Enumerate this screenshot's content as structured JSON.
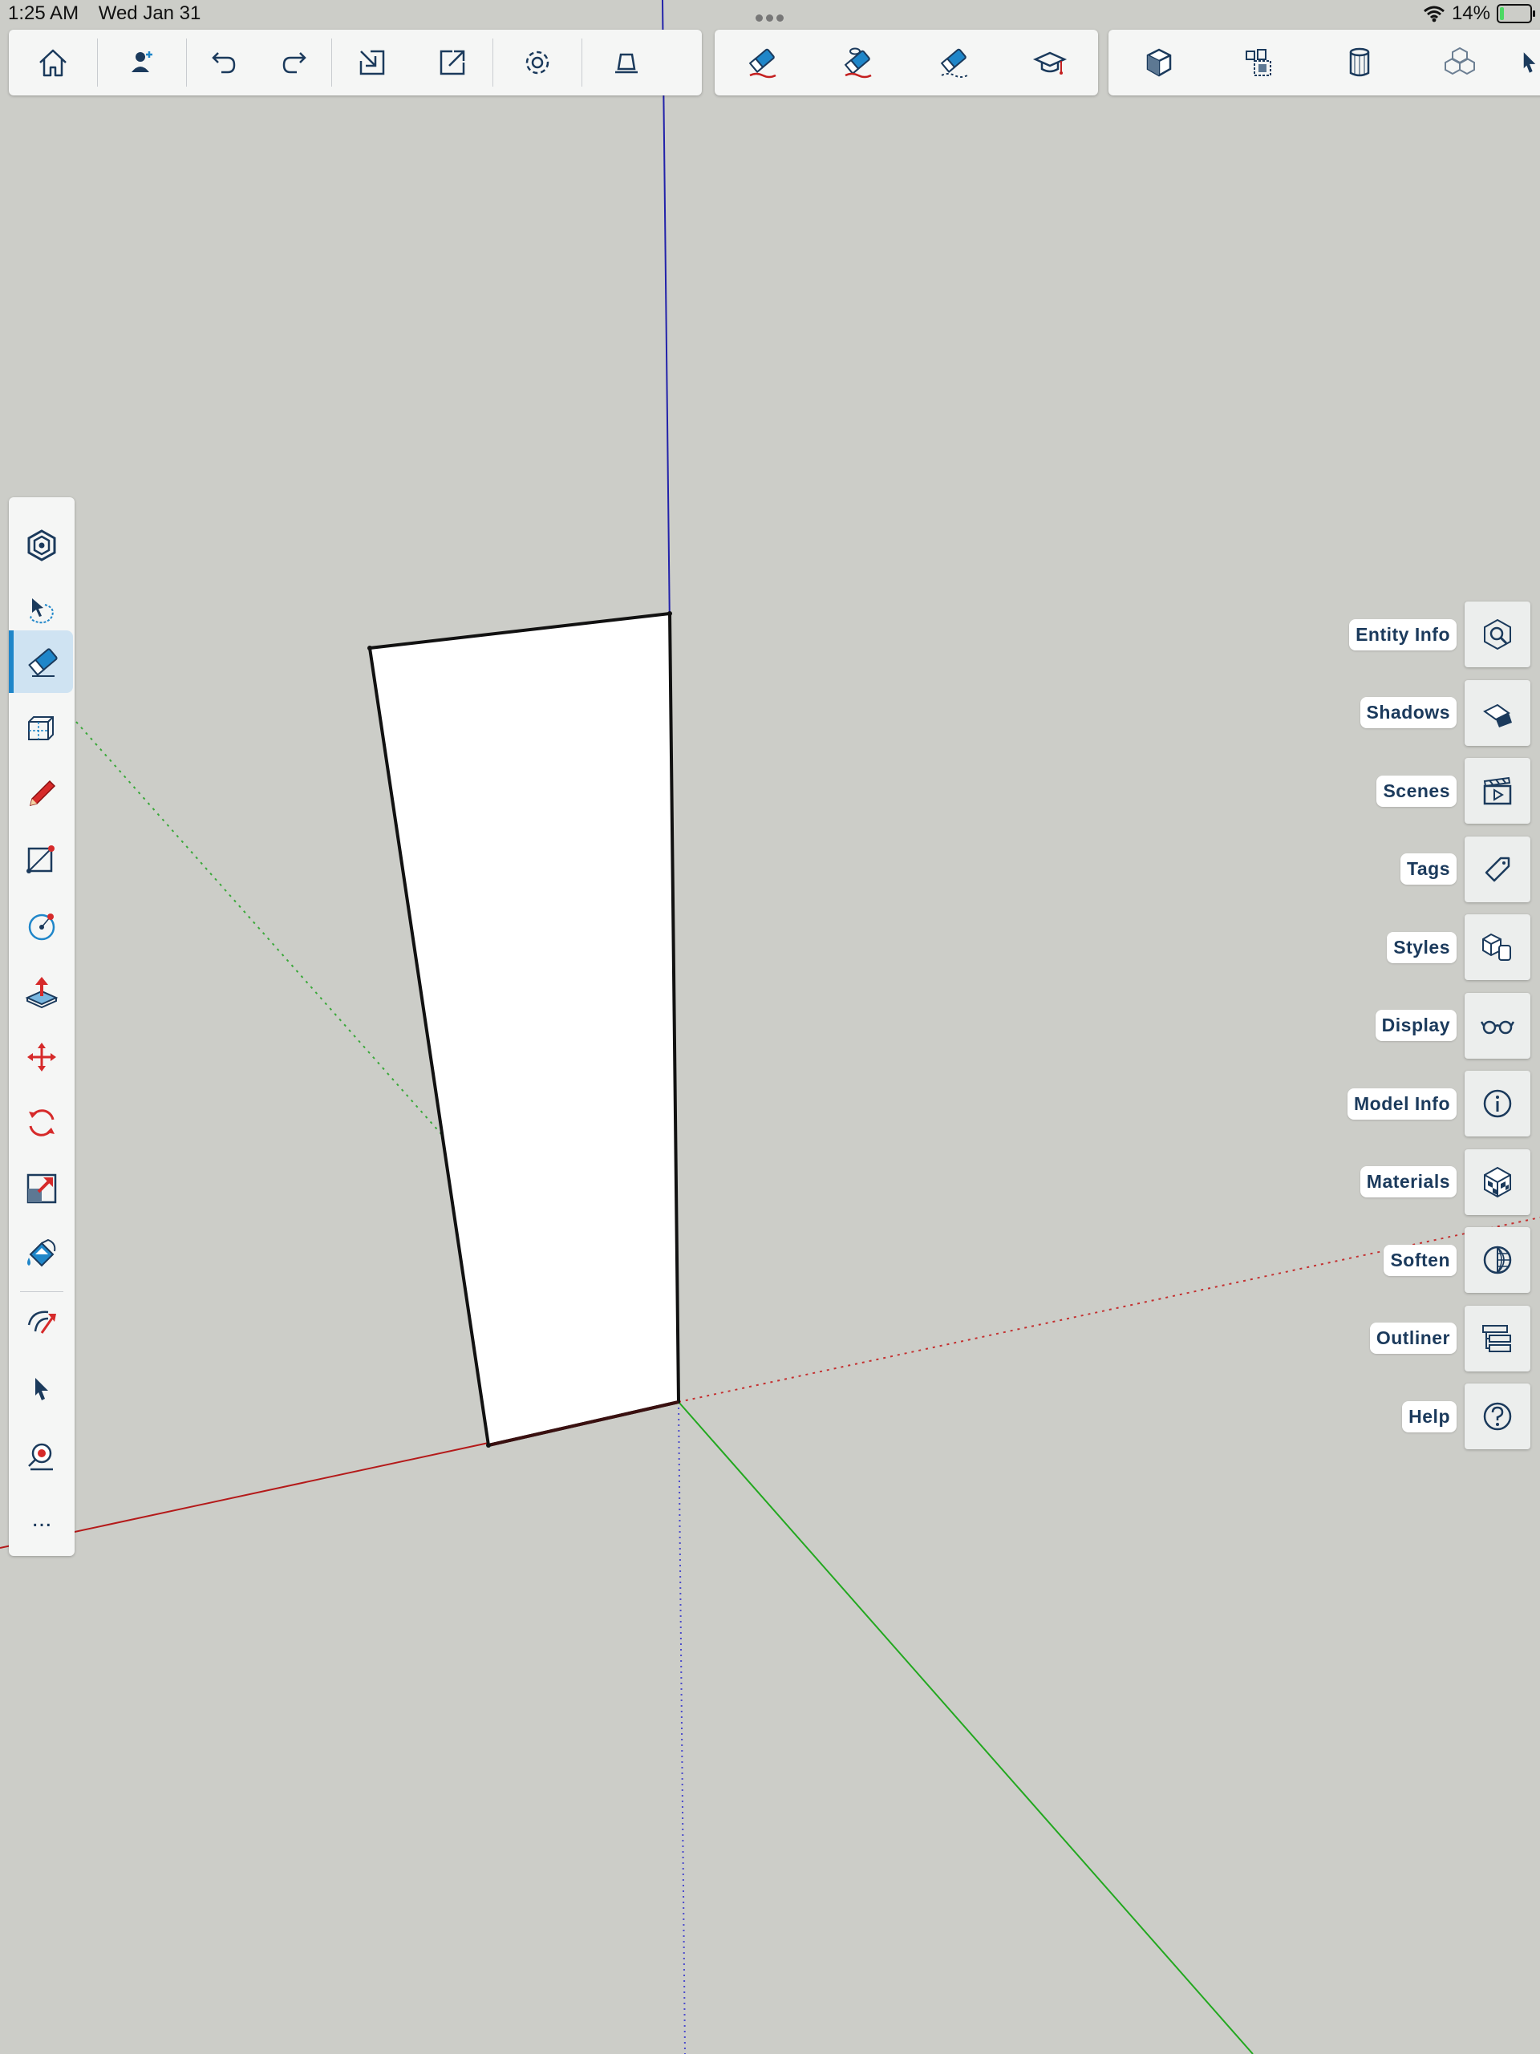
{
  "status": {
    "time": "1:25 AM",
    "date": "Wed Jan 31",
    "battery_text": "14%",
    "battery_level": 0.14
  },
  "top_toolbar": {
    "group1": [
      "home-icon",
      "add-user-icon",
      "undo-icon",
      "redo-icon",
      "import-icon",
      "export-icon",
      "settings-icon",
      "view-icon"
    ],
    "group2": [
      "eraser-tool-icon",
      "hide-eraser-icon",
      "soften-eraser-icon",
      "learn-icon"
    ],
    "group3": [
      "box-icon",
      "components-icon",
      "cylinder-icon",
      "cubes-icon",
      "more-arrow-icon"
    ]
  },
  "left_toolbar": {
    "items": [
      "orbit-icon",
      "lasso-select-icon",
      "eraser-icon",
      "box-select-icon",
      "pencil-icon",
      "line-rect-icon",
      "circle-icon",
      "push-pull-icon",
      "move-icon",
      "rotate-icon",
      "scale-icon",
      "paint-bucket-icon",
      "follow-me-icon",
      "select-arrow-icon",
      "tape-measure-icon"
    ],
    "more_label": "..."
  },
  "panels": [
    {
      "label": "Entity Info",
      "icon": "entity-info-icon"
    },
    {
      "label": "Shadows",
      "icon": "shadows-icon"
    },
    {
      "label": "Scenes",
      "icon": "scenes-icon"
    },
    {
      "label": "Tags",
      "icon": "tags-icon"
    },
    {
      "label": "Styles",
      "icon": "styles-icon"
    },
    {
      "label": "Display",
      "icon": "display-icon"
    },
    {
      "label": "Model Info",
      "icon": "model-info-icon"
    },
    {
      "label": "Materials",
      "icon": "materials-icon"
    },
    {
      "label": "Soften",
      "icon": "soften-icon"
    },
    {
      "label": "Outliner",
      "icon": "outliner-icon"
    },
    {
      "label": "Help",
      "icon": "help-icon"
    }
  ],
  "colors": {
    "canvas": "#cccdc8",
    "accent": "#1f86c9",
    "icon": "#1b3a5c",
    "red_axis": "#b41a1a",
    "green_axis": "#22a81f",
    "blue_axis": "#2222aa"
  }
}
